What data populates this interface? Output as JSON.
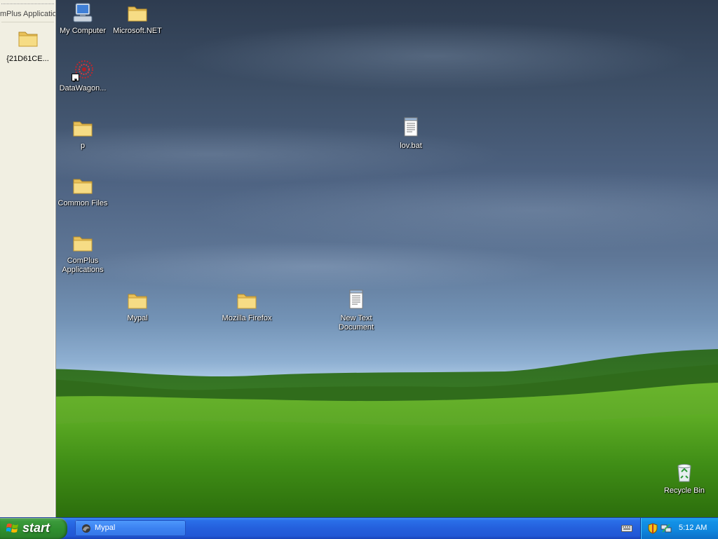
{
  "side_pane": {
    "title": "mPlus Applicatio",
    "item": {
      "label": "{21D61CE..."
    }
  },
  "desktop_icons": {
    "my_computer": "My Computer",
    "microsoft_net": "Microsoft.NET",
    "datawagon": "DataWagon...",
    "p": "p",
    "lov_bat": "lov.bat",
    "common_files": "Common Files",
    "complus_line1": "ComPlus",
    "complus_line2": "Applications",
    "mypal": "Mypal",
    "mozilla_firefox": "Mozilla Firefox",
    "new_text_line1": "New Text",
    "new_text_line2": "Document",
    "recycle_bin": "Recycle Bin"
  },
  "taskbar": {
    "start_label": "start",
    "task_item": "Mypal",
    "clock": "5:12 AM"
  },
  "colors": {
    "taskbar_blue": "#245fdc",
    "start_green": "#3b9a3b",
    "tray_blue": "#0f86dd"
  }
}
